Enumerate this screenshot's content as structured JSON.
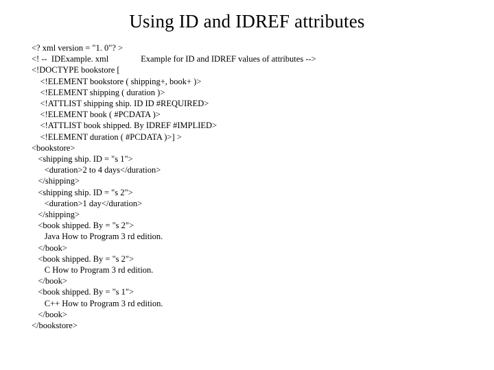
{
  "title": "Using ID and IDREF attributes",
  "lines": [
    "<? xml version = \"1. 0\"? >",
    "<! --  IDExample. xml               Example for ID and IDREF values of attributes -->",
    "<!DOCTYPE bookstore [",
    "    <!ELEMENT bookstore ( shipping+, book+ )>",
    "    <!ELEMENT shipping ( duration )>",
    "    <!ATTLIST shipping ship. ID ID #REQUIRED>",
    "    <!ELEMENT book ( #PCDATA )>",
    "    <!ATTLIST book shipped. By IDREF #IMPLIED>",
    "    <!ELEMENT duration ( #PCDATA )>] >",
    "<bookstore>",
    "   <shipping ship. ID = \"s 1\">",
    "      <duration>2 to 4 days</duration>",
    "   </shipping>",
    "   <shipping ship. ID = \"s 2\">",
    "      <duration>1 day</duration>",
    "   </shipping>",
    "   <book shipped. By = \"s 2\">",
    "      Java How to Program 3 rd edition.",
    "   </book>",
    "   <book shipped. By = \"s 2\">",
    "      C How to Program 3 rd edition.",
    "   </book>",
    "   <book shipped. By = \"s 1\">",
    "      C++ How to Program 3 rd edition.",
    "   </book>",
    "</bookstore>"
  ]
}
